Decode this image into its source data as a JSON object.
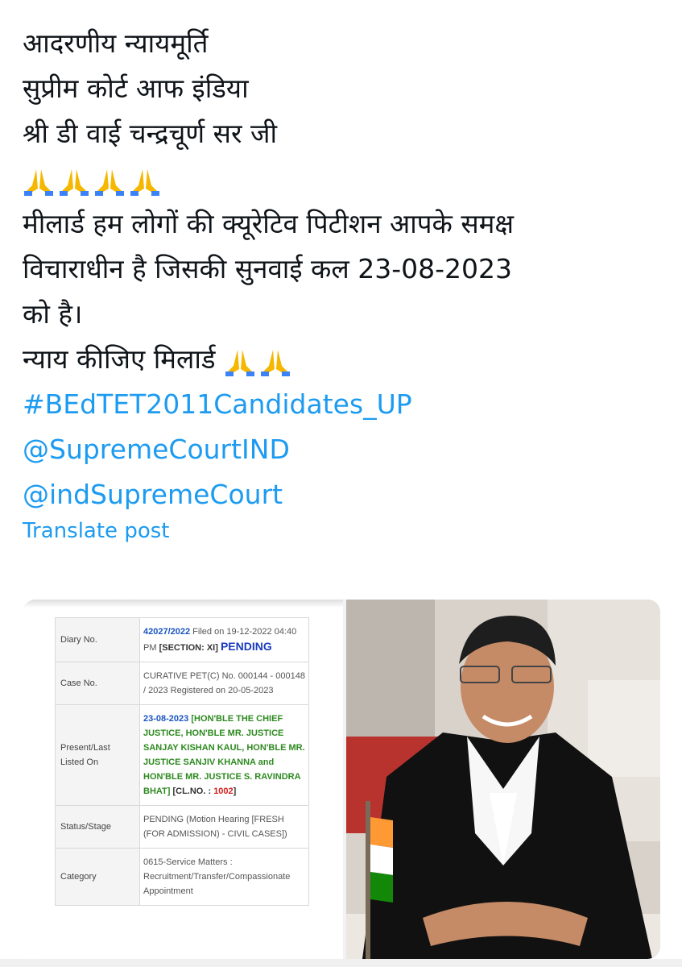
{
  "post": {
    "lines": [
      "आदरणीय न्यायमूर्ति",
      "सुप्रीम कोर्ट आफ इंडिया",
      "श्री डी वाई चन्द्रचूर्ण सर जी",
      "मीलार्ड हम लोगों की क्यूरेटिव पिटीशन आपके समक्ष",
      "विचाराधीन है जिसकी सुनवाई कल 23-08-2023",
      "को है।",
      "न्याय कीजिए मिलार्ड"
    ],
    "hashtag": "#BEdTET2011Candidates_UP",
    "mention_1": "@SupremeCourtIND",
    "mention_2": "@indSupremeCourt",
    "emoji": "folded-hands-icon",
    "translate_label": "Translate post"
  },
  "case_details": {
    "diary_label": "Diary No.",
    "diary_number": "42027/2022",
    "diary_filed": " Filed on 19-12-2022 04:40 PM ",
    "diary_section": "[SECTION: XI]",
    "diary_status": "PENDING",
    "case_label": "Case No.",
    "case_value": "CURATIVE PET(C) No. 000144 - 000148 / 2023 Registered on 20-05-2023",
    "listed_label": "Present/Last Listed On",
    "listed_date": "23-08-2023",
    "listed_bench": " [HON'BLE THE CHIEF JUSTICE, HON'BLE MR. JUSTICE SANJAY KISHAN KAUL, HON'BLE MR. JUSTICE SANJIV KHANNA and HON'BLE MR. JUSTICE S. RAVINDRA BHAT]",
    "listed_clno_prefix": " [CL.NO. : ",
    "listed_clno": "1002",
    "listed_clno_suffix": "]",
    "status_label": "Status/Stage",
    "status_value": "PENDING (Motion Hearing [FRESH (FOR ADMISSION) - CIVIL CASES])",
    "category_label": "Category",
    "category_value": "0615-Service Matters : Recruitment/Transfer/Compassionate Appointment"
  },
  "colors": {
    "link": "#1d9bf0",
    "text": "#0f1419",
    "pending": "#1a3bc0",
    "listed": "#2d8a1f"
  }
}
